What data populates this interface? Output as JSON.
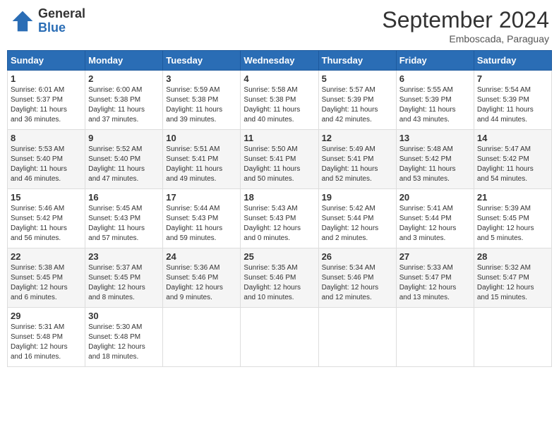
{
  "header": {
    "logo_general": "General",
    "logo_blue": "Blue",
    "month_title": "September 2024",
    "location": "Emboscada, Paraguay"
  },
  "weekdays": [
    "Sunday",
    "Monday",
    "Tuesday",
    "Wednesday",
    "Thursday",
    "Friday",
    "Saturday"
  ],
  "weeks": [
    [
      {
        "day": "1",
        "sunrise": "6:01 AM",
        "sunset": "5:37 PM",
        "daylight": "11 hours and 36 minutes."
      },
      {
        "day": "2",
        "sunrise": "6:00 AM",
        "sunset": "5:38 PM",
        "daylight": "11 hours and 37 minutes."
      },
      {
        "day": "3",
        "sunrise": "5:59 AM",
        "sunset": "5:38 PM",
        "daylight": "11 hours and 39 minutes."
      },
      {
        "day": "4",
        "sunrise": "5:58 AM",
        "sunset": "5:38 PM",
        "daylight": "11 hours and 40 minutes."
      },
      {
        "day": "5",
        "sunrise": "5:57 AM",
        "sunset": "5:39 PM",
        "daylight": "11 hours and 42 minutes."
      },
      {
        "day": "6",
        "sunrise": "5:55 AM",
        "sunset": "5:39 PM",
        "daylight": "11 hours and 43 minutes."
      },
      {
        "day": "7",
        "sunrise": "5:54 AM",
        "sunset": "5:39 PM",
        "daylight": "11 hours and 44 minutes."
      }
    ],
    [
      {
        "day": "8",
        "sunrise": "5:53 AM",
        "sunset": "5:40 PM",
        "daylight": "11 hours and 46 minutes."
      },
      {
        "day": "9",
        "sunrise": "5:52 AM",
        "sunset": "5:40 PM",
        "daylight": "11 hours and 47 minutes."
      },
      {
        "day": "10",
        "sunrise": "5:51 AM",
        "sunset": "5:41 PM",
        "daylight": "11 hours and 49 minutes."
      },
      {
        "day": "11",
        "sunrise": "5:50 AM",
        "sunset": "5:41 PM",
        "daylight": "11 hours and 50 minutes."
      },
      {
        "day": "12",
        "sunrise": "5:49 AM",
        "sunset": "5:41 PM",
        "daylight": "11 hours and 52 minutes."
      },
      {
        "day": "13",
        "sunrise": "5:48 AM",
        "sunset": "5:42 PM",
        "daylight": "11 hours and 53 minutes."
      },
      {
        "day": "14",
        "sunrise": "5:47 AM",
        "sunset": "5:42 PM",
        "daylight": "11 hours and 54 minutes."
      }
    ],
    [
      {
        "day": "15",
        "sunrise": "5:46 AM",
        "sunset": "5:42 PM",
        "daylight": "11 hours and 56 minutes."
      },
      {
        "day": "16",
        "sunrise": "5:45 AM",
        "sunset": "5:43 PM",
        "daylight": "11 hours and 57 minutes."
      },
      {
        "day": "17",
        "sunrise": "5:44 AM",
        "sunset": "5:43 PM",
        "daylight": "11 hours and 59 minutes."
      },
      {
        "day": "18",
        "sunrise": "5:43 AM",
        "sunset": "5:43 PM",
        "daylight": "12 hours and 0 minutes."
      },
      {
        "day": "19",
        "sunrise": "5:42 AM",
        "sunset": "5:44 PM",
        "daylight": "12 hours and 2 minutes."
      },
      {
        "day": "20",
        "sunrise": "5:41 AM",
        "sunset": "5:44 PM",
        "daylight": "12 hours and 3 minutes."
      },
      {
        "day": "21",
        "sunrise": "5:39 AM",
        "sunset": "5:45 PM",
        "daylight": "12 hours and 5 minutes."
      }
    ],
    [
      {
        "day": "22",
        "sunrise": "5:38 AM",
        "sunset": "5:45 PM",
        "daylight": "12 hours and 6 minutes."
      },
      {
        "day": "23",
        "sunrise": "5:37 AM",
        "sunset": "5:45 PM",
        "daylight": "12 hours and 8 minutes."
      },
      {
        "day": "24",
        "sunrise": "5:36 AM",
        "sunset": "5:46 PM",
        "daylight": "12 hours and 9 minutes."
      },
      {
        "day": "25",
        "sunrise": "5:35 AM",
        "sunset": "5:46 PM",
        "daylight": "12 hours and 10 minutes."
      },
      {
        "day": "26",
        "sunrise": "5:34 AM",
        "sunset": "5:46 PM",
        "daylight": "12 hours and 12 minutes."
      },
      {
        "day": "27",
        "sunrise": "5:33 AM",
        "sunset": "5:47 PM",
        "daylight": "12 hours and 13 minutes."
      },
      {
        "day": "28",
        "sunrise": "5:32 AM",
        "sunset": "5:47 PM",
        "daylight": "12 hours and 15 minutes."
      }
    ],
    [
      {
        "day": "29",
        "sunrise": "5:31 AM",
        "sunset": "5:48 PM",
        "daylight": "12 hours and 16 minutes."
      },
      {
        "day": "30",
        "sunrise": "5:30 AM",
        "sunset": "5:48 PM",
        "daylight": "12 hours and 18 minutes."
      },
      null,
      null,
      null,
      null,
      null
    ]
  ]
}
